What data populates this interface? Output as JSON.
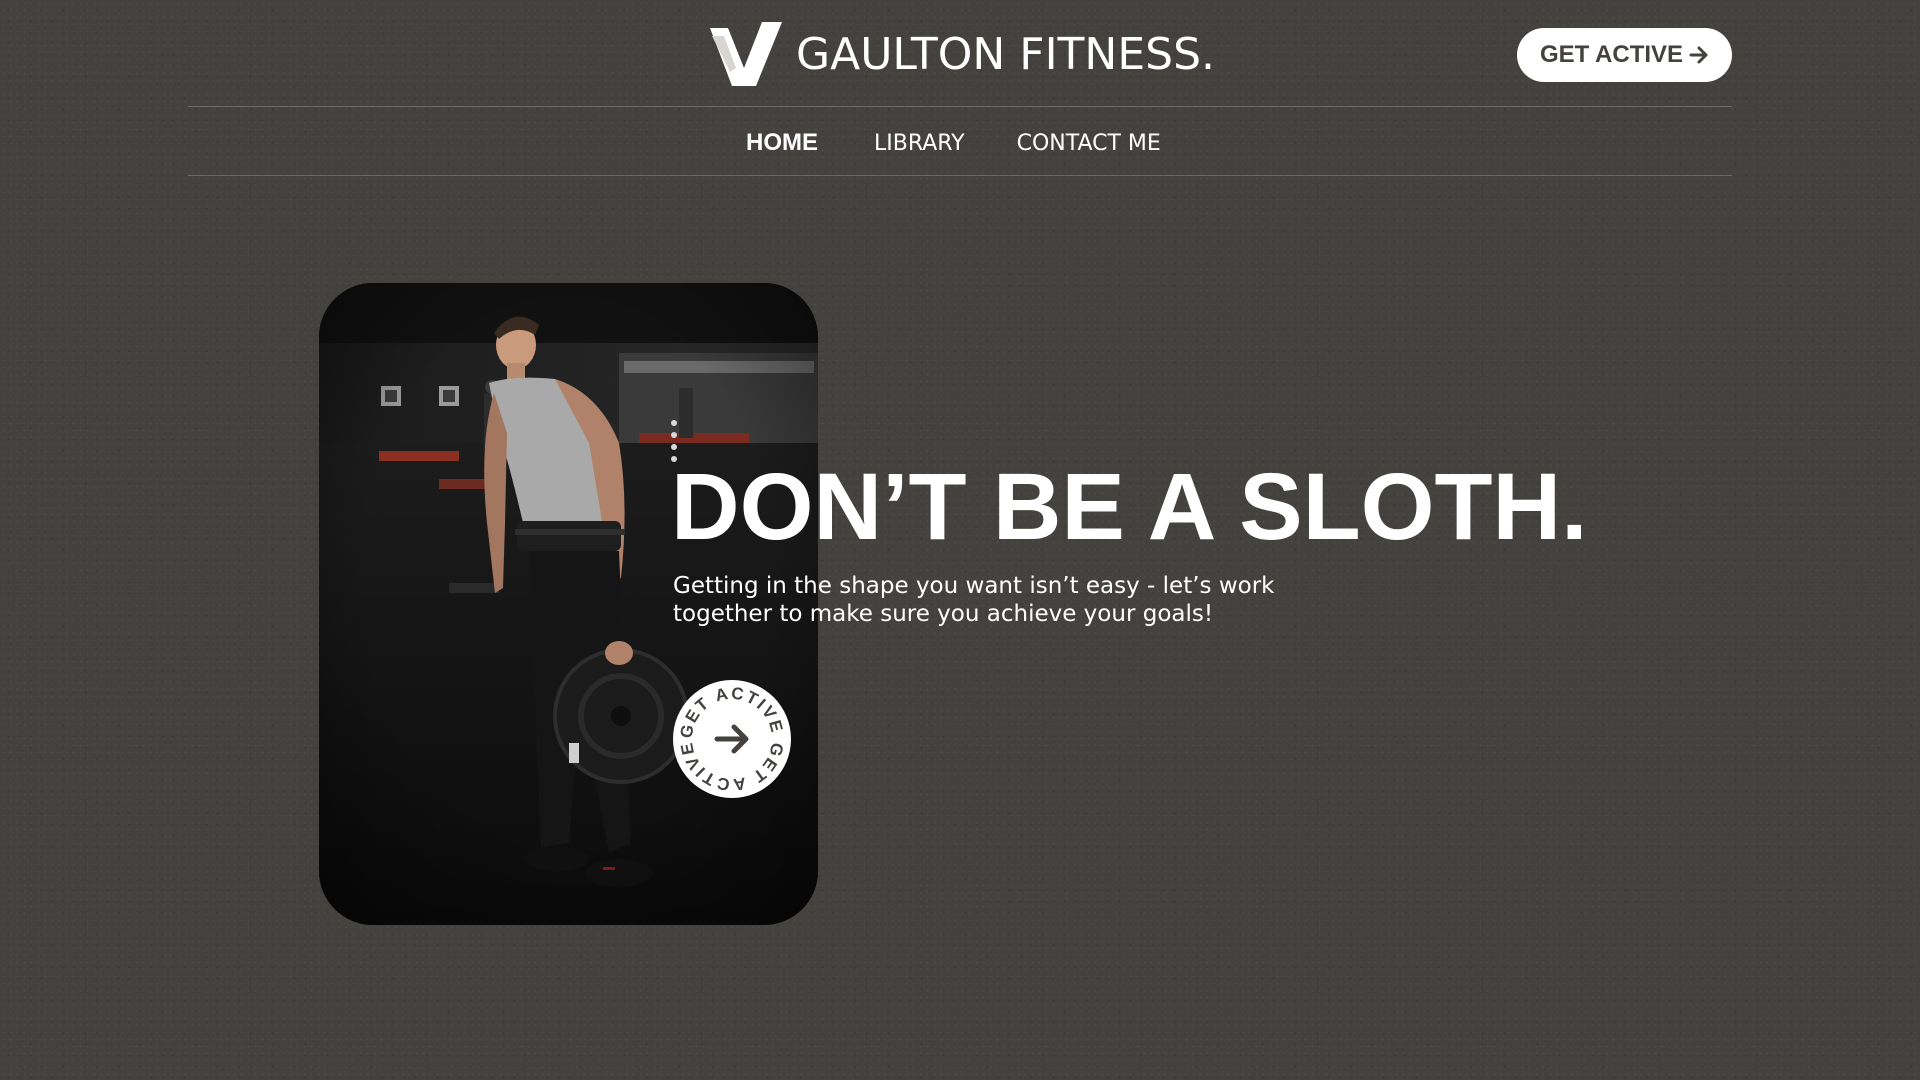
{
  "header": {
    "brand_name": "GAULTON FITNESS.",
    "cta_label": "GET ACTIVE"
  },
  "nav": {
    "items": [
      {
        "label": "HOME",
        "active": true
      },
      {
        "label": "LIBRARY",
        "active": false
      },
      {
        "label": "CONTACT ME",
        "active": false
      }
    ]
  },
  "hero": {
    "headline": "DON’T BE A SLOTH.",
    "subtext": "Getting in the shape you want isn’t easy - let’s work together to make sure you achieve your goals!",
    "badge_text": "GET ACTIVE GET ACTIVE",
    "image_alt": "Man in gym holding a weight plate"
  },
  "icons": {
    "logo": "v-logo-icon",
    "cta_arrow": "arrow-right-icon",
    "badge_arrow": "arrow-right-icon"
  },
  "colors": {
    "background": "#44423e",
    "text": "#ffffff",
    "button_bg": "#ffffff",
    "button_text": "#44423e"
  }
}
